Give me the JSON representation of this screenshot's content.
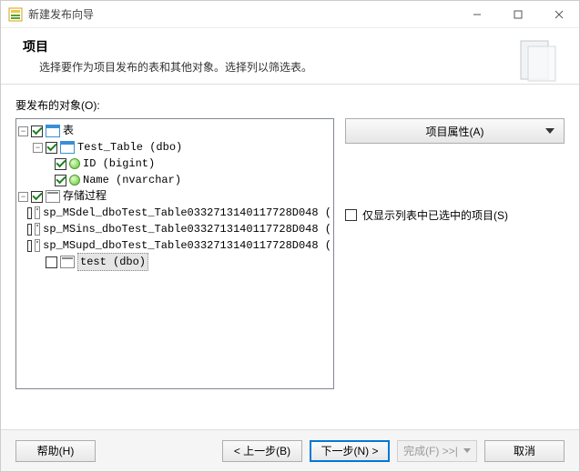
{
  "window": {
    "title": "新建发布向导"
  },
  "banner": {
    "heading": "项目",
    "sub": "选择要作为项目发布的表和其他对象。选择列以筛选表。"
  },
  "prompt": "要发布的对象(O):",
  "tree": {
    "tables_label": "表",
    "test_table": "Test_Table (dbo)",
    "col_id": "ID (bigint)",
    "col_name": "Name (nvarchar)",
    "procs_label": "存储过程",
    "p1": "sp_MSdel_dboTest_Table0332713140117728D048 (",
    "p2": "sp_MSins_dboTest_Table0332713140117728D048 (",
    "p3": "sp_MSupd_dboTest_Table0332713140117728D048 (",
    "p4": "test (dbo)"
  },
  "right": {
    "properties_btn": "项目属性(A)",
    "only_selected": "仅显示列表中已选中的项目(S)"
  },
  "footer": {
    "help": "帮助(H)",
    "back": "< 上一步(B)",
    "next": "下一步(N) >",
    "finish": "完成(F) >>|",
    "cancel": "取消"
  }
}
